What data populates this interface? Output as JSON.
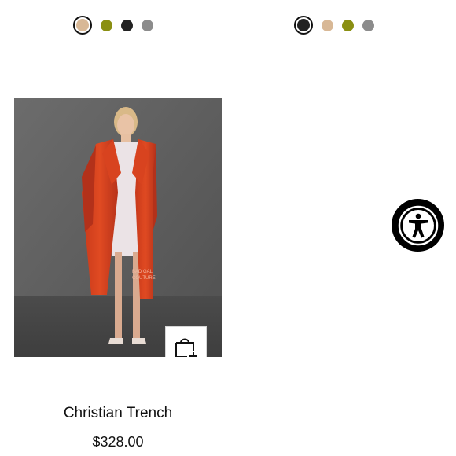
{
  "swatch_groups": [
    {
      "swatches": [
        {
          "color": "#d8b896",
          "selected": true
        },
        {
          "color": "#8a8f12",
          "selected": false
        },
        {
          "color": "#222222",
          "selected": false
        },
        {
          "color": "#8c8c8c",
          "selected": false
        }
      ]
    },
    {
      "swatches": [
        {
          "color": "#222222",
          "selected": true
        },
        {
          "color": "#d8b896",
          "selected": false
        },
        {
          "color": "#8a8f12",
          "selected": false
        },
        {
          "color": "#8c8c8c",
          "selected": false
        }
      ]
    }
  ],
  "product": {
    "name": "Christian Trench",
    "price": "$328.00",
    "image_icon": "product-photo",
    "add_to_bag_icon": "bag-plus-icon"
  },
  "accessibility": {
    "icon": "accessibility-icon"
  }
}
